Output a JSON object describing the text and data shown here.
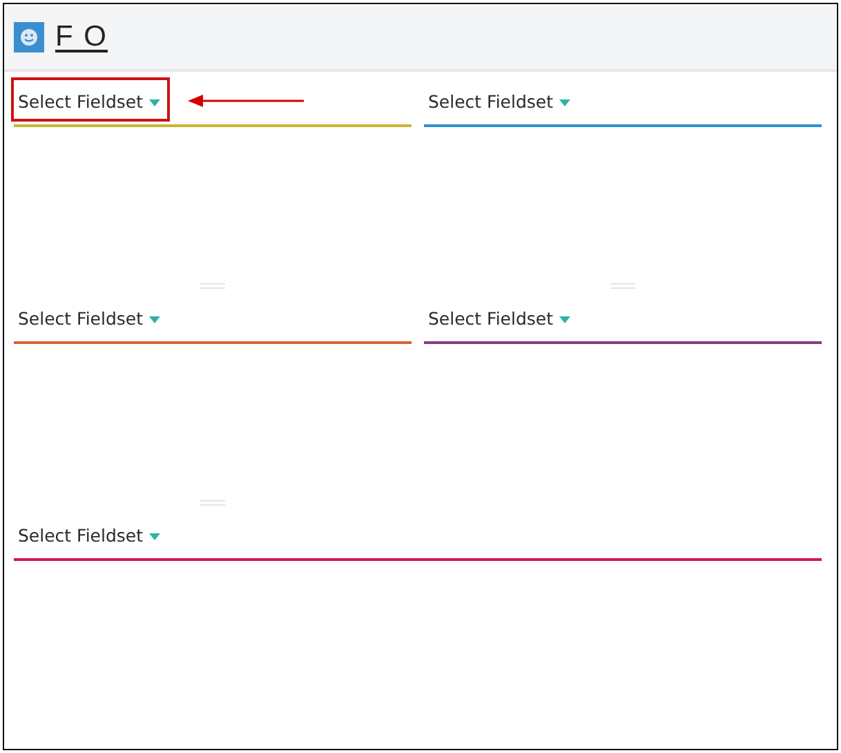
{
  "header": {
    "title": "F O"
  },
  "panels": [
    {
      "label": "Select Fieldset",
      "color": "#c8b631",
      "kind": "half",
      "highlighted": true
    },
    {
      "label": "Select Fieldset",
      "color": "#2d8fd2",
      "kind": "half",
      "highlighted": false
    },
    {
      "label": "Select Fieldset",
      "color": "#d2663a",
      "kind": "half",
      "highlighted": false
    },
    {
      "label": "Select Fieldset",
      "color": "#8a3b7c",
      "kind": "half",
      "highlighted": false
    },
    {
      "label": "Select Fieldset",
      "color": "#d3174c",
      "kind": "full",
      "highlighted": false
    }
  ]
}
